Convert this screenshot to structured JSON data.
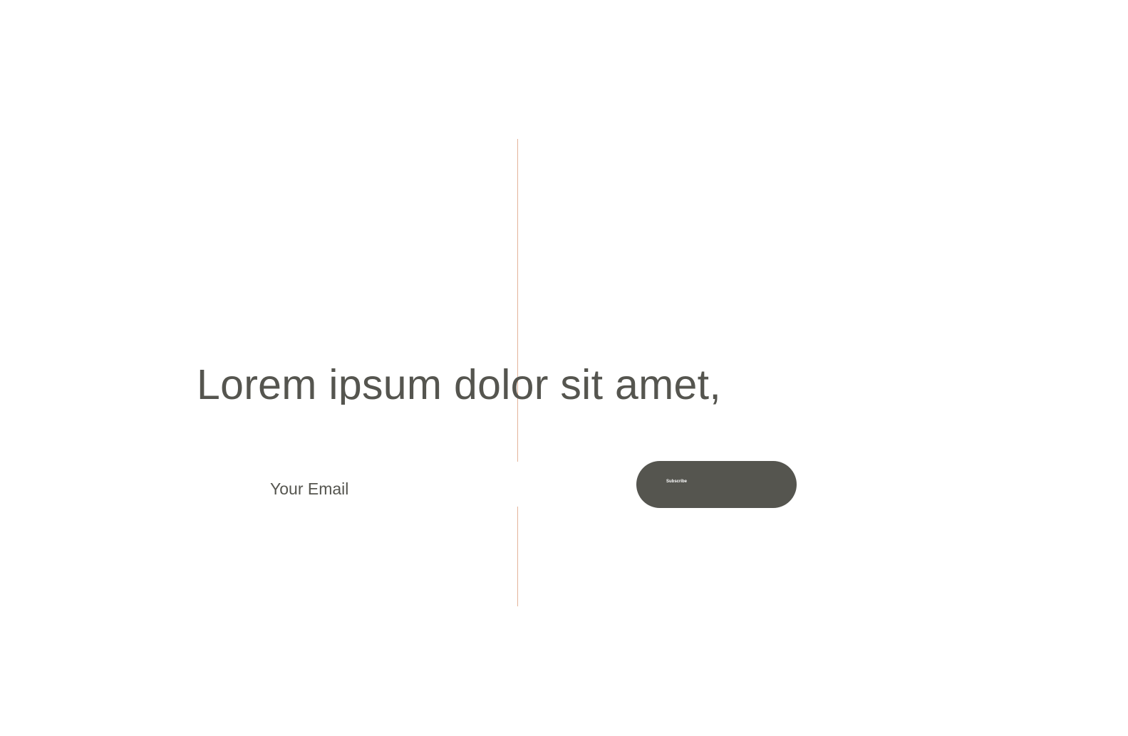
{
  "hero": {
    "headline": "Lorem ipsum dolor sit amet,"
  },
  "newsletter": {
    "email_placeholder": "Your Email",
    "subscribe_label": "Subscribe"
  },
  "colors": {
    "text": "#55554f",
    "button_bg": "#55554f",
    "button_text": "#ffffff",
    "divider": "#e3b49a",
    "background": "#ffffff"
  }
}
